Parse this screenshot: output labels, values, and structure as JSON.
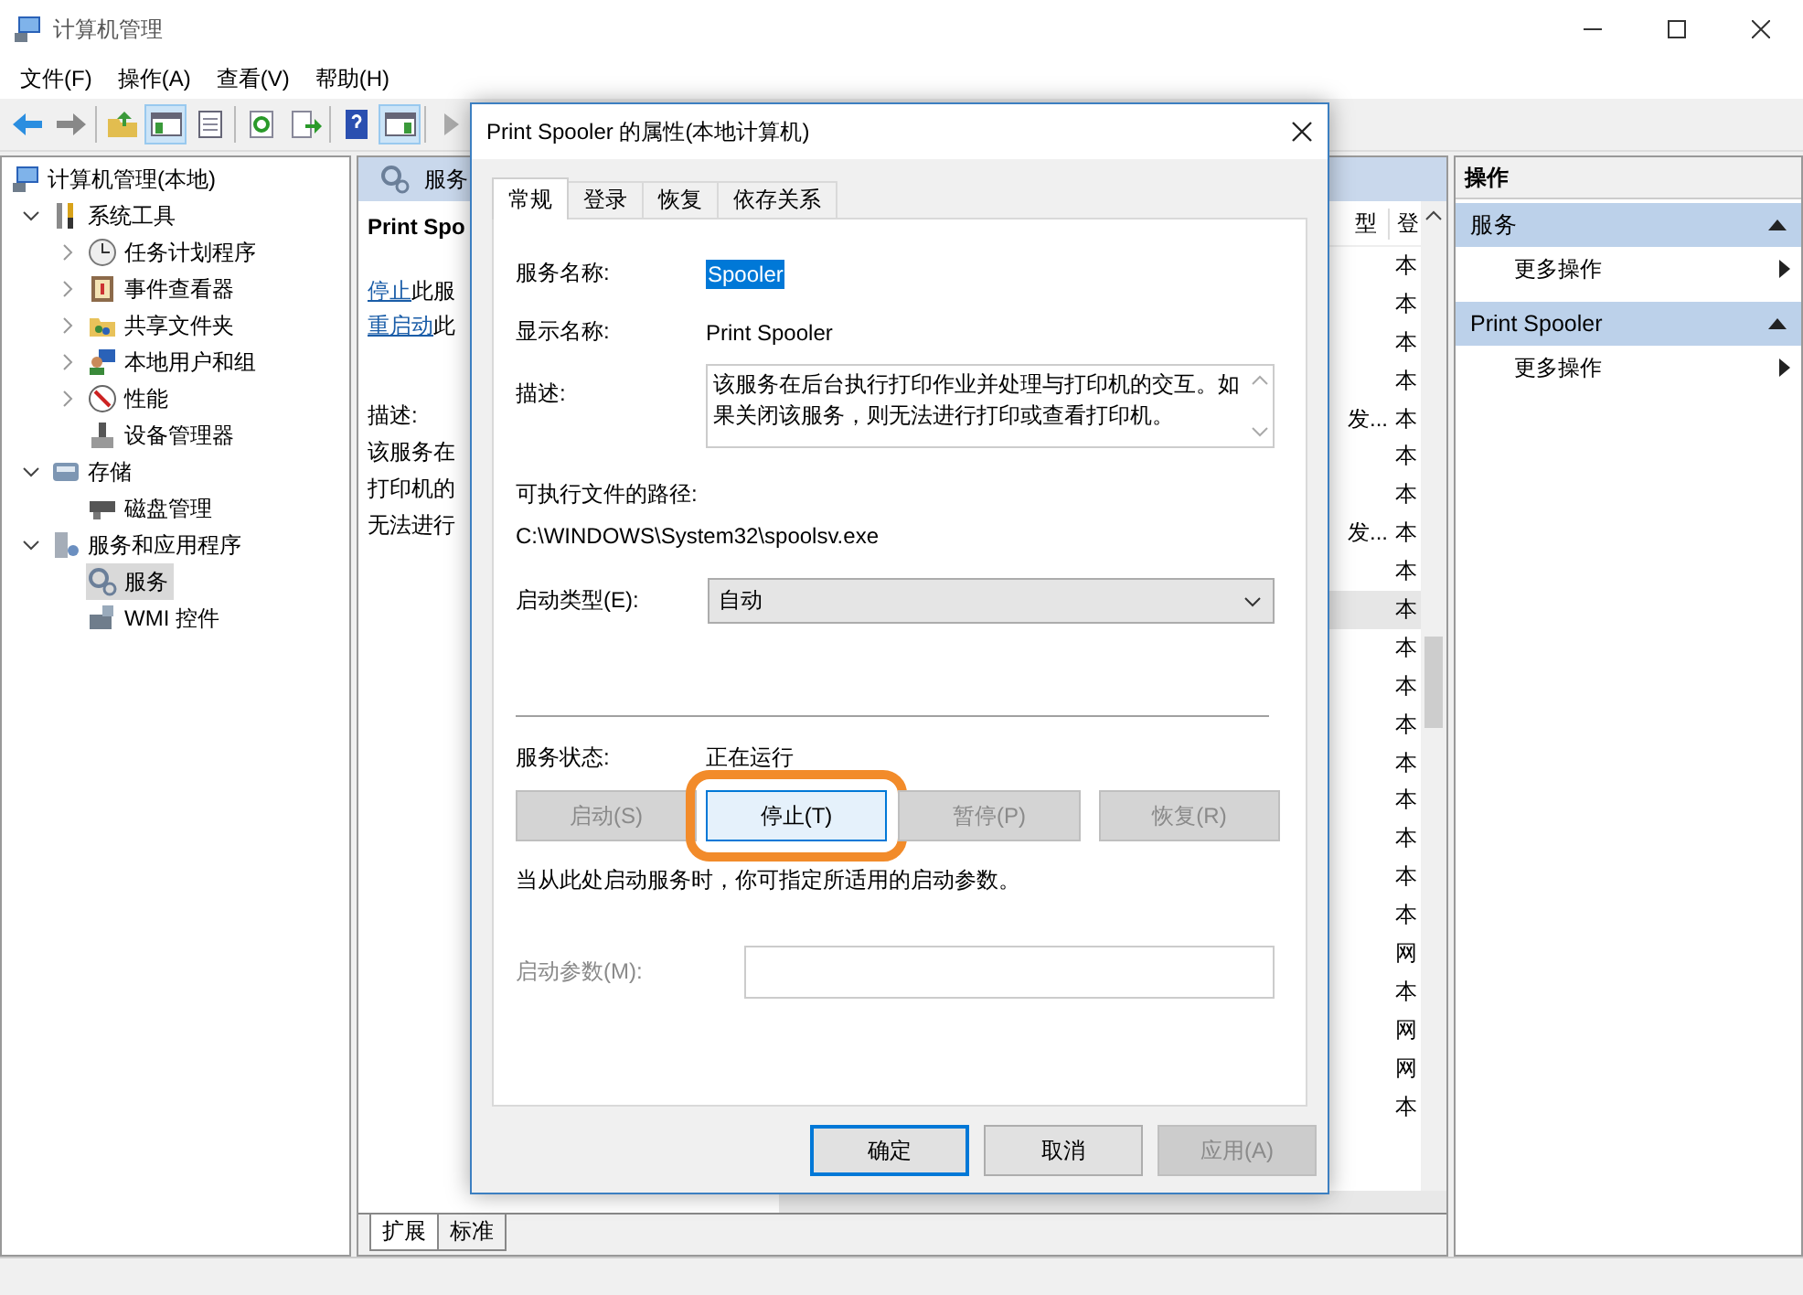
{
  "window": {
    "title": "计算机管理"
  },
  "menu": [
    "文件(F)",
    "操作(A)",
    "查看(V)",
    "帮助(H)"
  ],
  "toolbar": [
    {
      "kind": "back",
      "pressed": false
    },
    {
      "kind": "forward",
      "pressed": false
    },
    {
      "kind": "up",
      "pressed": false
    },
    {
      "kind": "tree",
      "pressed": true
    },
    {
      "kind": "list",
      "pressed": false
    },
    {
      "kind": "refresh",
      "pressed": false
    },
    {
      "kind": "export",
      "pressed": false
    },
    {
      "kind": "help",
      "pressed": false
    },
    {
      "kind": "actions",
      "pressed": true
    },
    {
      "kind": "play",
      "pressed": false
    }
  ],
  "tree": [
    {
      "label": "计算机管理(本地)",
      "kind": "computer",
      "selected": false,
      "children": [
        {
          "label": "系统工具",
          "kind": "tools",
          "selected": false,
          "expanded": true,
          "children": [
            {
              "label": "任务计划程序",
              "kind": "clock",
              "selected": false,
              "expanded": false
            },
            {
              "label": "事件查看器",
              "kind": "event",
              "selected": false,
              "expanded": false
            },
            {
              "label": "共享文件夹",
              "kind": "folder",
              "selected": false,
              "expanded": false
            },
            {
              "label": "本地用户和组",
              "kind": "users",
              "selected": false,
              "expanded": false
            },
            {
              "label": "性能",
              "kind": "perf",
              "selected": false,
              "expanded": false
            },
            {
              "label": "设备管理器",
              "kind": "device",
              "selected": false
            }
          ]
        },
        {
          "label": "存储",
          "kind": "storage",
          "selected": false,
          "expanded": true,
          "children": [
            {
              "label": "磁盘管理",
              "kind": "disk",
              "selected": false
            }
          ]
        },
        {
          "label": "服务和应用程序",
          "kind": "apps",
          "selected": false,
          "expanded": true,
          "children": [
            {
              "label": "服务",
              "kind": "services",
              "selected": true
            },
            {
              "label": "WMI 控件",
              "kind": "wmi",
              "selected": false
            }
          ]
        }
      ]
    }
  ],
  "services_pane": {
    "header": "服务",
    "name": "Print Spo",
    "links": [
      {
        "link": "停止",
        "rest": "此服"
      },
      {
        "link": "重启动",
        "rest": "此"
      }
    ],
    "description_label": "描述:",
    "description_lines": [
      "该服务在",
      "打印机的",
      "无法进行"
    ],
    "columns": [
      "型",
      "登"
    ],
    "rows": [
      {
        "column_1": "",
        "column_2": "本",
        "selected": false
      },
      {
        "column_1": "",
        "column_2": "本",
        "selected": false
      },
      {
        "column_1": "",
        "column_2": "本",
        "selected": false
      },
      {
        "column_1": "",
        "column_2": "本",
        "selected": false
      },
      {
        "column_1": "发...",
        "column_2": "本",
        "selected": false
      },
      {
        "column_1": "",
        "column_2": "本",
        "selected": false
      },
      {
        "column_1": "",
        "column_2": "本",
        "selected": false
      },
      {
        "column_1": "发...",
        "column_2": "本",
        "selected": false
      },
      {
        "column_1": "",
        "column_2": "本",
        "selected": false
      },
      {
        "column_1": "",
        "column_2": "本",
        "selected": true
      },
      {
        "column_1": "",
        "column_2": "本",
        "selected": false
      },
      {
        "column_1": "",
        "column_2": "本",
        "selected": false
      },
      {
        "column_1": "",
        "column_2": "本",
        "selected": false
      },
      {
        "column_1": "",
        "column_2": "本",
        "selected": false
      },
      {
        "column_1": "",
        "column_2": "本",
        "selected": false
      },
      {
        "column_1": "",
        "column_2": "本",
        "selected": false
      },
      {
        "column_1": "",
        "column_2": "本",
        "selected": false
      },
      {
        "column_1": "",
        "column_2": "本",
        "selected": false
      },
      {
        "column_1": "",
        "column_2": "网",
        "selected": false
      },
      {
        "column_1": "",
        "column_2": "本",
        "selected": false
      },
      {
        "column_1": "",
        "column_2": "网",
        "selected": false
      },
      {
        "column_1": "",
        "column_2": "网",
        "selected": false
      },
      {
        "column_1": "",
        "column_2": "本",
        "selected": false
      }
    ],
    "tabs": [
      {
        "label": "扩展",
        "selected": true
      },
      {
        "label": "标准",
        "selected": false
      }
    ]
  },
  "actions_pane": {
    "title": "操作",
    "groups": [
      {
        "title": "服务",
        "items": [
          "更多操作"
        ]
      },
      {
        "title": "Print Spooler",
        "items": [
          "更多操作"
        ]
      }
    ]
  },
  "dialog": {
    "title": "Print Spooler 的属性(本地计算机)",
    "tabs": [
      {
        "label": "常规",
        "selected": true
      },
      {
        "label": "登录",
        "selected": false
      },
      {
        "label": "恢复",
        "selected": false
      },
      {
        "label": "依存关系",
        "selected": false
      }
    ],
    "service_name_label": "服务名称:",
    "service_name": "Spooler",
    "service_name_selected": true,
    "display_name_label": "显示名称:",
    "display_name": "Print Spooler",
    "description_label": "描述:",
    "description": "该服务在后台执行打印作业并处理与打印机的交互。如果关闭该服务，则无法进行打印或查看打印机。",
    "path_label": "可执行文件的路径:",
    "path": "C:\\WINDOWS\\System32\\spoolsv.exe",
    "startup_type_label": "启动类型(E):",
    "startup_type": "自动",
    "status_label": "服务状态:",
    "status": "正在运行",
    "service_buttons": [
      {
        "label": "启动(S)",
        "disabled": true,
        "highlighted": false
      },
      {
        "label": "停止(T)",
        "disabled": false,
        "highlighted": true
      },
      {
        "label": "暂停(P)",
        "disabled": true,
        "highlighted": false
      },
      {
        "label": "恢复(R)",
        "disabled": true,
        "highlighted": false
      }
    ],
    "hint": "当从此处启动服务时，你可指定所适用的启动参数。",
    "params_label": "启动参数(M):",
    "params_disabled": true,
    "buttons": [
      {
        "label": "确定",
        "default": true,
        "disabled": false
      },
      {
        "label": "取消",
        "default": false,
        "disabled": false
      },
      {
        "label": "应用(A)",
        "default": false,
        "disabled": true
      }
    ]
  }
}
